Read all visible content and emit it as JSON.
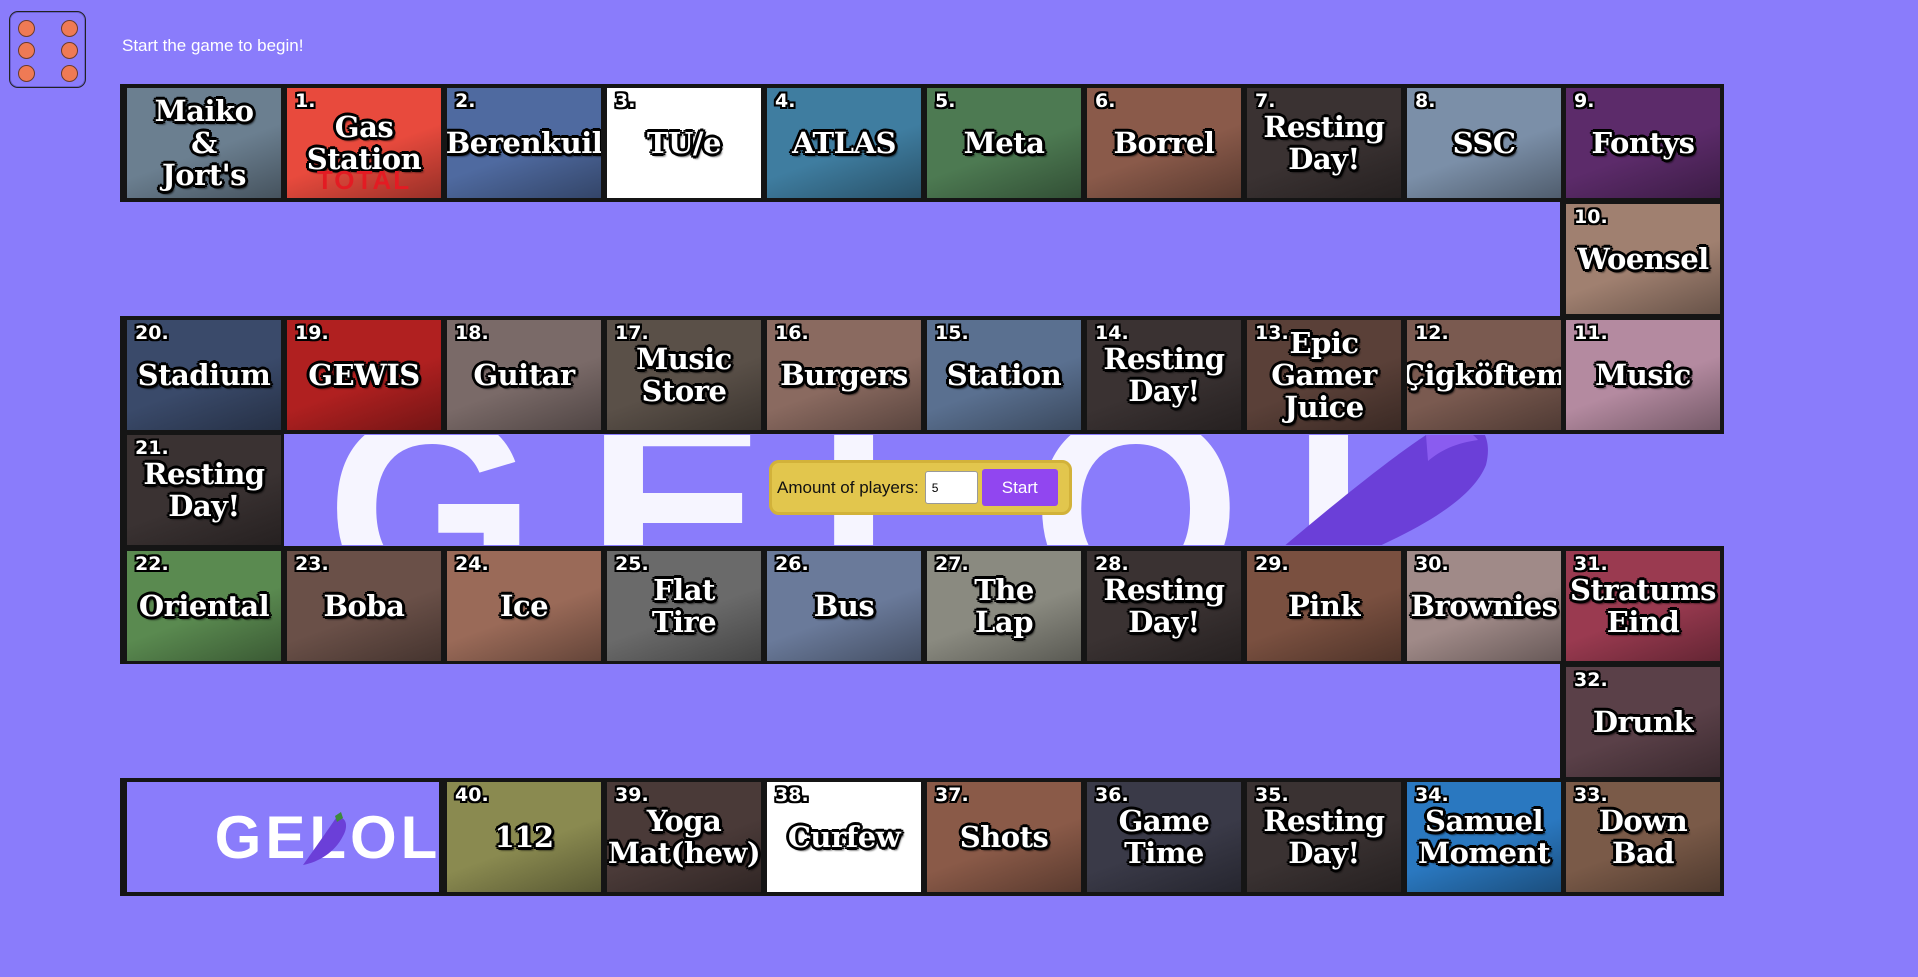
{
  "status_message": "Start the game to begin!",
  "dice": {
    "value": 6,
    "icon": "dice-six-icon"
  },
  "setup": {
    "label": "Amount of players:",
    "players_value": "5",
    "start_label": "Start"
  },
  "background_watermark": "GELOL",
  "logo": {
    "text": "GELOL",
    "icon": "eggplant-icon"
  },
  "tiles": [
    {
      "num": "",
      "label": "Maiko\n&\nJort's",
      "color": "#6b7f90"
    },
    {
      "num": "1.",
      "label": "Gas\nStation",
      "color": "#e84a3d",
      "sub": "TOTAL"
    },
    {
      "num": "2.",
      "label": "Berenkuil",
      "color": "#4f6aa0"
    },
    {
      "num": "3.",
      "label": "TU/e",
      "color": "#ffffff"
    },
    {
      "num": "4.",
      "label": "ATLAS",
      "color": "#3f7da0"
    },
    {
      "num": "5.",
      "label": "Meta",
      "color": "#4d7a52"
    },
    {
      "num": "6.",
      "label": "Borrel",
      "color": "#8a5a4a"
    },
    {
      "num": "7.",
      "label": "Resting\nDay!",
      "color": "#3a3232"
    },
    {
      "num": "8.",
      "label": "SSC",
      "color": "#7b8fa8"
    },
    {
      "num": "9.",
      "label": "Fontys",
      "color": "#5c2b6a"
    },
    {
      "num": "10.",
      "label": "Woensel",
      "color": "#a08070"
    },
    {
      "num": "11.",
      "label": "Music",
      "color": "#b48aa0"
    },
    {
      "num": "12.",
      "label": "Çigköftem",
      "color": "#7a5a50"
    },
    {
      "num": "13.",
      "label": "Epic\nGamer\nJuice",
      "color": "#5a4038"
    },
    {
      "num": "14.",
      "label": "Resting\nDay!",
      "color": "#3a3232"
    },
    {
      "num": "15.",
      "label": "Station",
      "color": "#5a7090"
    },
    {
      "num": "16.",
      "label": "Burgers",
      "color": "#8a6a60"
    },
    {
      "num": "17.",
      "label": "Music\nStore",
      "color": "#5a5048"
    },
    {
      "num": "18.",
      "label": "Guitar",
      "color": "#7a6a68"
    },
    {
      "num": "19.",
      "label": "GEWIS",
      "color": "#b02020"
    },
    {
      "num": "20.",
      "label": "Stadium",
      "color": "#3a4a6a"
    },
    {
      "num": "21.",
      "label": "Resting\nDay!",
      "color": "#3a3232"
    },
    {
      "num": "22.",
      "label": "Oriental",
      "color": "#5a8a50"
    },
    {
      "num": "23.",
      "label": "Boba",
      "color": "#6a5048"
    },
    {
      "num": "24.",
      "label": "Ice",
      "color": "#9a6a58"
    },
    {
      "num": "25.",
      "label": "Flat\nTire",
      "color": "#6a6a6a"
    },
    {
      "num": "26.",
      "label": "Bus",
      "color": "#6a7a9a"
    },
    {
      "num": "27.",
      "label": "The\nLap",
      "color": "#8a8a80"
    },
    {
      "num": "28.",
      "label": "Resting\nDay!",
      "color": "#3a3232"
    },
    {
      "num": "29.",
      "label": "Pink",
      "color": "#7a5040"
    },
    {
      "num": "30.",
      "label": "Brownies",
      "color": "#a08a88"
    },
    {
      "num": "31.",
      "label": "Stratums\nEind",
      "color": "#9a3a50"
    },
    {
      "num": "32.",
      "label": "Drunk",
      "color": "#5a4048"
    },
    {
      "num": "33.",
      "label": "Down\nBad",
      "color": "#7a5a48"
    },
    {
      "num": "34.",
      "label": "Samuel\nMoment",
      "color": "#2a78c0"
    },
    {
      "num": "35.",
      "label": "Resting\nDay!",
      "color": "#3a3232"
    },
    {
      "num": "36.",
      "label": "Game\nTime",
      "color": "#3a3a48"
    },
    {
      "num": "37.",
      "label": "Shots",
      "color": "#8a5a48"
    },
    {
      "num": "38.",
      "label": "Curfew",
      "color": "#ffffff"
    },
    {
      "num": "39.",
      "label": "Yoga\nMat(hew)",
      "color": "#4a3a38"
    },
    {
      "num": "40.",
      "label": "112",
      "color": "#8a8a50"
    }
  ]
}
